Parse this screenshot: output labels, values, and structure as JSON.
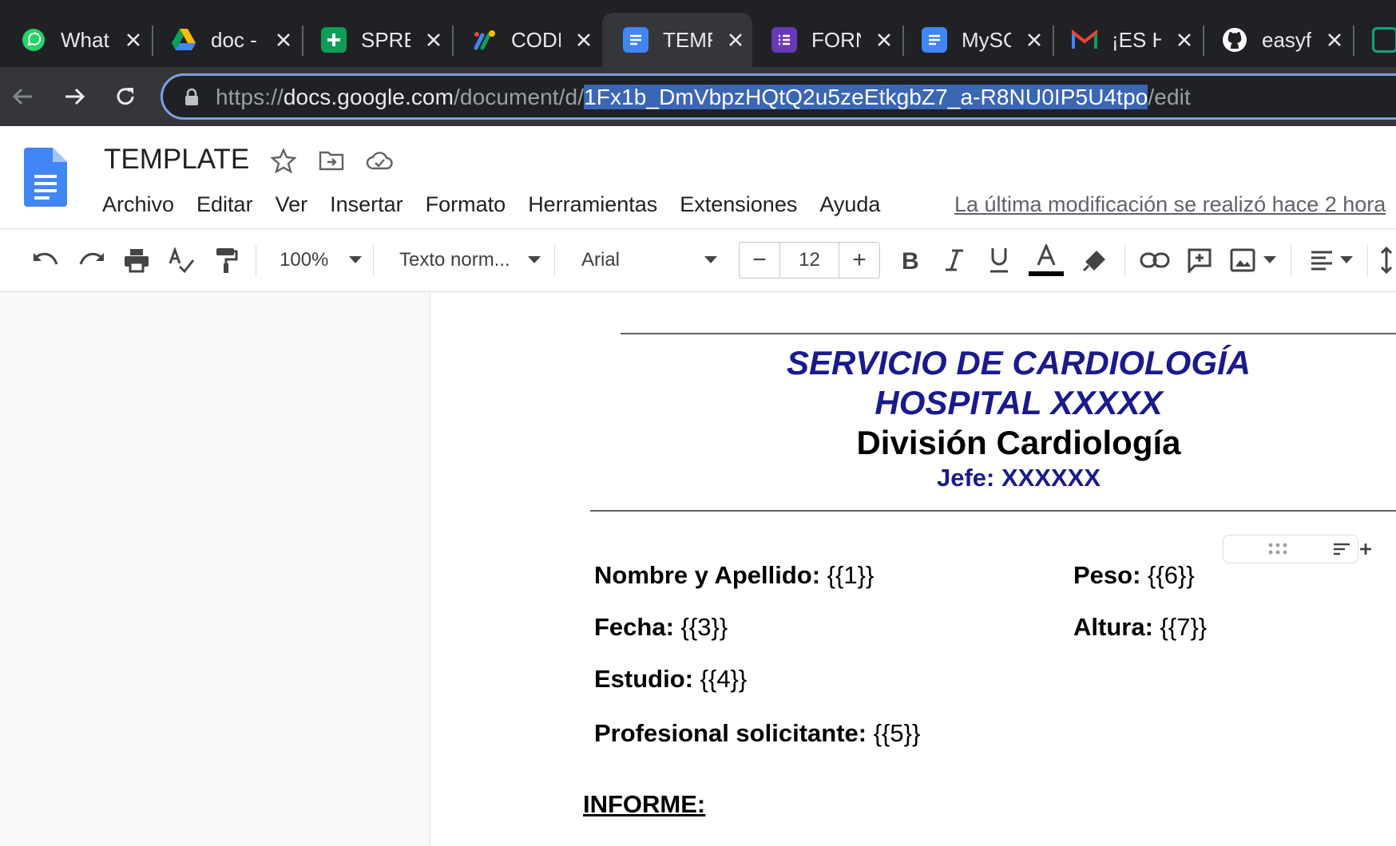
{
  "browser": {
    "tabs": [
      {
        "title": "What",
        "icon": "whatsapp-icon",
        "color": "#25d366"
      },
      {
        "title": "doc -",
        "icon": "google-drive-icon",
        "color": "#fbbc04"
      },
      {
        "title": "SPRE",
        "icon": "google-sheets-icon",
        "color": "#0f9d58"
      },
      {
        "title": "CODI",
        "icon": "apps-script-icon",
        "color": "#4285f4"
      },
      {
        "title": "TEMF",
        "icon": "google-docs-icon",
        "color": "#4285f4"
      },
      {
        "title": "FORN",
        "icon": "google-forms-icon",
        "color": "#673ab7"
      },
      {
        "title": "MySC",
        "icon": "google-docs-icon",
        "color": "#4285f4"
      },
      {
        "title": "¡ES H",
        "icon": "gmail-icon",
        "color": "#ea4335"
      },
      {
        "title": "easyf",
        "icon": "github-icon",
        "color": "#ffffff"
      }
    ],
    "url": {
      "scheme": "https://",
      "host": "docs.google.com",
      "path": "/document/d/",
      "doc_id": "1Fx1b_DmVbpzHQtQ2u5zeEtkgbZ7_a-R8NU0IP5U4tpo",
      "suffix": "/edit"
    }
  },
  "docs": {
    "title": "TEMPLATE",
    "menu": [
      "Archivo",
      "Editar",
      "Ver",
      "Insertar",
      "Formato",
      "Herramientas",
      "Extensiones",
      "Ayuda"
    ],
    "last_modified": "La última modificación se realizó hace 2 hora"
  },
  "toolbar": {
    "zoom": "100%",
    "style": "Texto norm...",
    "font": "Arial",
    "font_size": "12",
    "minus": "−",
    "plus": "+",
    "text_color": "#000000"
  },
  "document": {
    "header_line1": "SERVICIO DE CARDIOLOGÍA",
    "header_line2": "HOSPITAL XXXXX",
    "header_line3": "División Cardiología",
    "header_line4": "Jefe: XXXXXX",
    "fields": {
      "nombre_label": "Nombre y Apellido:",
      "nombre_value": " {{1}}",
      "fecha_label": "Fecha:",
      "fecha_value": " {{3}}",
      "estudio_label": "Estudio:",
      "estudio_value": " {{4}}",
      "profesional_label": "Profesional solicitante:",
      "profesional_value": " {{5}}",
      "peso_label": "Peso:",
      "peso_value": " {{6}}",
      "altura_label": "Altura:",
      "altura_value": " {{7}}"
    },
    "informe": "INFORME:"
  }
}
